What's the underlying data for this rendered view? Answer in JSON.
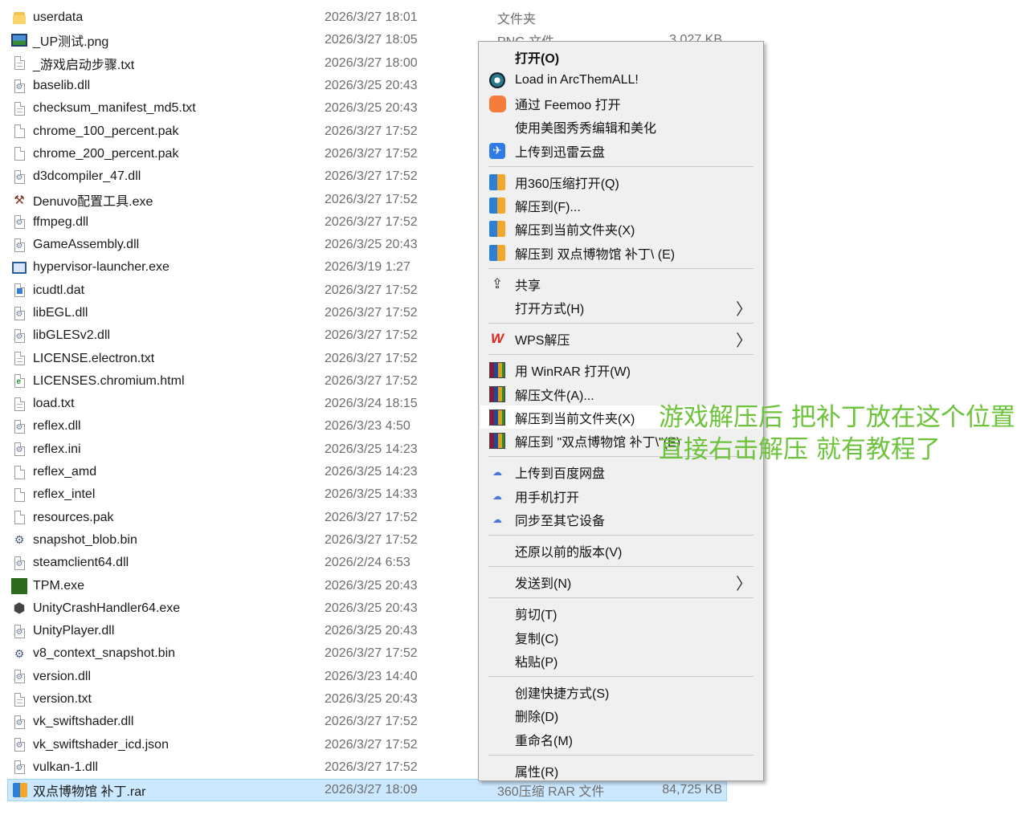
{
  "file_list": [
    {
      "icon": "folder-icon",
      "name": "userdata",
      "date": "2026/3/27 18:01",
      "type": "文件夹",
      "size": ""
    },
    {
      "icon": "image-icon",
      "name": "_UP测试.png",
      "date": "2026/3/27 18:05",
      "type": "PNG 文件",
      "size": "3,027 KB"
    },
    {
      "icon": "text-file-icon",
      "name": "_游戏启动步骤.txt",
      "date": "2026/3/27 18:00",
      "type": "",
      "size": ""
    },
    {
      "icon": "dll-file-icon",
      "name": "baselib.dll",
      "date": "2026/3/25 20:43",
      "type": "",
      "size": ""
    },
    {
      "icon": "text-file-icon",
      "name": "checksum_manifest_md5.txt",
      "date": "2026/3/25 20:43",
      "type": "",
      "size": ""
    },
    {
      "icon": "blank-file-icon",
      "name": "chrome_100_percent.pak",
      "date": "2026/3/27 17:52",
      "type": "",
      "size": ""
    },
    {
      "icon": "blank-file-icon",
      "name": "chrome_200_percent.pak",
      "date": "2026/3/27 17:52",
      "type": "",
      "size": ""
    },
    {
      "icon": "dll-file-icon",
      "name": "d3dcompiler_47.dll",
      "date": "2026/3/27 17:52",
      "type": "",
      "size": ""
    },
    {
      "icon": "denuvo-exe-icon",
      "name": "Denuvo配置工具.exe",
      "date": "2026/3/27 17:52",
      "type": "",
      "size": ""
    },
    {
      "icon": "dll-file-icon",
      "name": "ffmpeg.dll",
      "date": "2026/3/27 17:52",
      "type": "",
      "size": ""
    },
    {
      "icon": "dll-file-icon",
      "name": "GameAssembly.dll",
      "date": "2026/3/25 20:43",
      "type": "",
      "size": ""
    },
    {
      "icon": "exe-window-icon",
      "name": "hypervisor-launcher.exe",
      "date": "2026/3/19 1:27",
      "type": "",
      "size": ""
    },
    {
      "icon": "dat-file-icon",
      "name": "icudtl.dat",
      "date": "2026/3/27 17:52",
      "type": "",
      "size": ""
    },
    {
      "icon": "dll-file-icon",
      "name": "libEGL.dll",
      "date": "2026/3/27 17:52",
      "type": "",
      "size": ""
    },
    {
      "icon": "dll-file-icon",
      "name": "libGLESv2.dll",
      "date": "2026/3/27 17:52",
      "type": "",
      "size": ""
    },
    {
      "icon": "text-file-icon",
      "name": "LICENSE.electron.txt",
      "date": "2026/3/27 17:52",
      "type": "",
      "size": ""
    },
    {
      "icon": "html-file-icon",
      "name": "LICENSES.chromium.html",
      "date": "2026/3/27 17:52",
      "type": "",
      "size": ""
    },
    {
      "icon": "text-file-icon",
      "name": "load.txt",
      "date": "2026/3/24 18:15",
      "type": "",
      "size": ""
    },
    {
      "icon": "dll-file-icon",
      "name": "reflex.dll",
      "date": "2026/3/23 4:50",
      "type": "",
      "size": ""
    },
    {
      "icon": "ini-file-icon",
      "name": "reflex.ini",
      "date": "2026/3/25 14:23",
      "type": "",
      "size": ""
    },
    {
      "icon": "blank-file-icon",
      "name": "reflex_amd",
      "date": "2026/3/25 14:23",
      "type": "",
      "size": ""
    },
    {
      "icon": "blank-file-icon",
      "name": "reflex_intel",
      "date": "2026/3/25 14:33",
      "type": "",
      "size": ""
    },
    {
      "icon": "blank-file-icon",
      "name": "resources.pak",
      "date": "2026/3/27 17:52",
      "type": "",
      "size": ""
    },
    {
      "icon": "bin-file-icon",
      "name": "snapshot_blob.bin",
      "date": "2026/3/27 17:52",
      "type": "",
      "size": ""
    },
    {
      "icon": "dll-file-icon",
      "name": "steamclient64.dll",
      "date": "2026/2/24 6:53",
      "type": "",
      "size": ""
    },
    {
      "icon": "tpm-exe-icon",
      "name": "TPM.exe",
      "date": "2026/3/25 20:43",
      "type": "",
      "size": ""
    },
    {
      "icon": "unity-icon",
      "name": "UnityCrashHandler64.exe",
      "date": "2026/3/25 20:43",
      "type": "",
      "size": ""
    },
    {
      "icon": "dll-file-icon",
      "name": "UnityPlayer.dll",
      "date": "2026/3/25 20:43",
      "type": "",
      "size": ""
    },
    {
      "icon": "bin-file-icon",
      "name": "v8_context_snapshot.bin",
      "date": "2026/3/27 17:52",
      "type": "",
      "size": ""
    },
    {
      "icon": "dll-file-icon",
      "name": "version.dll",
      "date": "2026/3/23 14:40",
      "type": "",
      "size": ""
    },
    {
      "icon": "text-file-icon",
      "name": "version.txt",
      "date": "2026/3/25 20:43",
      "type": "",
      "size": ""
    },
    {
      "icon": "dll-file-icon",
      "name": "vk_swiftshader.dll",
      "date": "2026/3/27 17:52",
      "type": "",
      "size": ""
    },
    {
      "icon": "json-file-icon",
      "name": "vk_swiftshader_icd.json",
      "date": "2026/3/27 17:52",
      "type": "",
      "size": ""
    },
    {
      "icon": "dll-file-icon",
      "name": "vulkan-1.dll",
      "date": "2026/3/27 17:52",
      "type": "",
      "size": ""
    },
    {
      "icon": "rar-archive-icon",
      "name": "双点博物馆 补丁.rar",
      "date": "2026/3/27 18:09",
      "type": "360压缩 RAR 文件",
      "size": "84,725 KB",
      "selected": true
    }
  ],
  "context_menu": {
    "items": [
      {
        "label": "打开(O)",
        "icon": "",
        "bold": true
      },
      {
        "label": "Load in ArcThemALL!",
        "icon": "arcthemall-icon"
      },
      {
        "label": "通过 Feemoo 打开",
        "icon": "feemoo-icon"
      },
      {
        "label": "使用美图秀秀编辑和美化",
        "icon": ""
      },
      {
        "label": "上传到迅雷云盘",
        "icon": "xunlei-icon"
      },
      {
        "separator": true
      },
      {
        "label": "用360压缩打开(Q)",
        "icon": "360zip-icon"
      },
      {
        "label": "解压到(F)...",
        "icon": "360zip-icon"
      },
      {
        "label": "解压到当前文件夹(X)",
        "icon": "360zip-icon"
      },
      {
        "label": "解压到 双点博物馆 补丁\\ (E)",
        "icon": "360zip-icon"
      },
      {
        "separator": true
      },
      {
        "label": "共享",
        "icon": "share-icon"
      },
      {
        "label": "打开方式(H)",
        "icon": "",
        "submenu": true
      },
      {
        "separator": true
      },
      {
        "label": "WPS解压",
        "icon": "wps-icon",
        "submenu": true
      },
      {
        "separator": true
      },
      {
        "label": "用 WinRAR 打开(W)",
        "icon": "winrar-icon"
      },
      {
        "label": "解压文件(A)...",
        "icon": "winrar-icon"
      },
      {
        "label": "解压到当前文件夹(X)",
        "icon": "winrar-icon",
        "hover": true
      },
      {
        "label": "解压到 \"双点博物馆 补丁\\\"(E)",
        "icon": "winrar-icon"
      },
      {
        "separator": true
      },
      {
        "label": "上传到百度网盘",
        "icon": "baidu-netdisk-icon"
      },
      {
        "label": "用手机打开",
        "icon": "baidu-netdisk-icon"
      },
      {
        "label": "同步至其它设备",
        "icon": "baidu-netdisk-icon"
      },
      {
        "separator": true
      },
      {
        "label": "还原以前的版本(V)",
        "icon": ""
      },
      {
        "separator": true
      },
      {
        "label": "发送到(N)",
        "icon": "",
        "submenu": true
      },
      {
        "separator": true
      },
      {
        "label": "剪切(T)",
        "icon": ""
      },
      {
        "label": "复制(C)",
        "icon": ""
      },
      {
        "label": "粘贴(P)",
        "icon": ""
      },
      {
        "separator": true
      },
      {
        "label": "创建快捷方式(S)",
        "icon": ""
      },
      {
        "label": "删除(D)",
        "icon": ""
      },
      {
        "label": "重命名(M)",
        "icon": ""
      },
      {
        "separator": true
      },
      {
        "label": "属性(R)",
        "icon": ""
      }
    ]
  },
  "annotation": {
    "line1": "游戏解压后 把补丁放在这个位置",
    "line2": "直接右击解压 就有教程了",
    "color": "#6dc33c"
  },
  "colors": {
    "selection_bg": "#cce8ff",
    "menu_bg": "#f0f0f0",
    "date_gray": "#6d6d6d"
  }
}
